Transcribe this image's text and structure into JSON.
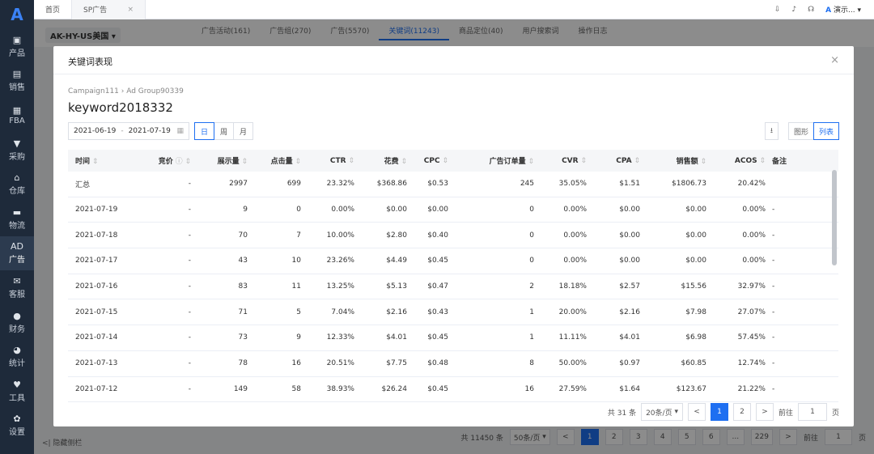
{
  "sidebar": {
    "logo": "A",
    "items": [
      {
        "icon": "box-icon",
        "glyph": "▣",
        "label": "产品"
      },
      {
        "icon": "shop-icon",
        "glyph": "▤",
        "label": "销售"
      },
      {
        "icon": "fba-icon",
        "glyph": "▦",
        "label": "FBA"
      },
      {
        "icon": "cart-icon",
        "glyph": "▼",
        "label": "采购"
      },
      {
        "icon": "warehouse-icon",
        "glyph": "⌂",
        "label": "仓库"
      },
      {
        "icon": "truck-icon",
        "glyph": "▬",
        "label": "物流"
      },
      {
        "icon": "ad-icon",
        "glyph": "AD",
        "label": "广告"
      },
      {
        "icon": "mail-icon",
        "glyph": "✉",
        "label": "客服"
      },
      {
        "icon": "finance-icon",
        "glyph": "●",
        "label": "财务"
      },
      {
        "icon": "pie-icon",
        "glyph": "◕",
        "label": "统计"
      },
      {
        "icon": "tool-icon",
        "glyph": "♥",
        "label": "工具"
      },
      {
        "icon": "gear-icon",
        "glyph": "✿",
        "label": "设置"
      }
    ]
  },
  "topbar": {
    "tabs": [
      {
        "label": "首页"
      },
      {
        "label": "SP广告"
      }
    ],
    "close_glyph": "×",
    "user": "演示..."
  },
  "background": {
    "shop": "AK-HY-US美国",
    "tabs": [
      "广告活动(161)",
      "广告组(270)",
      "广告(5570)",
      "关键词(11243)",
      "商品定位(40)",
      "用户搜索词",
      "操作日志"
    ],
    "hide_label": "<| 隐藏侧栏",
    "footer": {
      "total": "共 11450 条",
      "page_size": "50条/页",
      "pages": [
        "1",
        "2",
        "3",
        "4",
        "5",
        "6",
        "...",
        "229"
      ],
      "goto_label": "前往",
      "goto_value": "1",
      "page_suffix": "页"
    }
  },
  "modal": {
    "title": "关键词表现",
    "close": "×",
    "breadcrumb": "Campaign111  ›  Ad Group90339",
    "keyword": "keyword2018332",
    "date_start": "2021-06-19",
    "date_sep": "-",
    "date_end": "2021-07-19",
    "granularity": [
      "日",
      "周",
      "月"
    ],
    "download": "⭳",
    "view_chart": "图形",
    "view_list": "列表",
    "columns": [
      "时间",
      "竞价",
      "展示量",
      "点击量",
      "CTR",
      "花费",
      "CPC",
      "广告订单量",
      "CVR",
      "CPA",
      "销售额",
      "ACOS",
      "备注"
    ],
    "rows": [
      [
        "汇总",
        "-",
        "2997",
        "699",
        "23.32%",
        "$368.86",
        "$0.53",
        "245",
        "35.05%",
        "$1.51",
        "$1806.73",
        "20.42%",
        ""
      ],
      [
        "2021-07-19",
        "-",
        "9",
        "0",
        "0.00%",
        "$0.00",
        "$0.00",
        "0",
        "0.00%",
        "$0.00",
        "$0.00",
        "0.00%",
        "-"
      ],
      [
        "2021-07-18",
        "-",
        "70",
        "7",
        "10.00%",
        "$2.80",
        "$0.40",
        "0",
        "0.00%",
        "$0.00",
        "$0.00",
        "0.00%",
        "-"
      ],
      [
        "2021-07-17",
        "-",
        "43",
        "10",
        "23.26%",
        "$4.49",
        "$0.45",
        "0",
        "0.00%",
        "$0.00",
        "$0.00",
        "0.00%",
        "-"
      ],
      [
        "2021-07-16",
        "-",
        "83",
        "11",
        "13.25%",
        "$5.13",
        "$0.47",
        "2",
        "18.18%",
        "$2.57",
        "$15.56",
        "32.97%",
        "-"
      ],
      [
        "2021-07-15",
        "-",
        "71",
        "5",
        "7.04%",
        "$2.16",
        "$0.43",
        "1",
        "20.00%",
        "$2.16",
        "$7.98",
        "27.07%",
        "-"
      ],
      [
        "2021-07-14",
        "-",
        "73",
        "9",
        "12.33%",
        "$4.01",
        "$0.45",
        "1",
        "11.11%",
        "$4.01",
        "$6.98",
        "57.45%",
        "-"
      ],
      [
        "2021-07-13",
        "-",
        "78",
        "16",
        "20.51%",
        "$7.75",
        "$0.48",
        "8",
        "50.00%",
        "$0.97",
        "$60.85",
        "12.74%",
        "-"
      ],
      [
        "2021-07-12",
        "-",
        "149",
        "58",
        "38.93%",
        "$26.24",
        "$0.45",
        "16",
        "27.59%",
        "$1.64",
        "$123.67",
        "21.22%",
        "-"
      ]
    ],
    "pager": {
      "total": "共 31 条",
      "page_size": "20条/页",
      "prev": "<",
      "pages": [
        "1",
        "2"
      ],
      "next": ">",
      "goto_label": "前往",
      "goto_value": "1",
      "page_suffix": "页"
    }
  },
  "colors": {
    "accent": "#1e6ff1",
    "sidebar": "#1e2a3a"
  }
}
